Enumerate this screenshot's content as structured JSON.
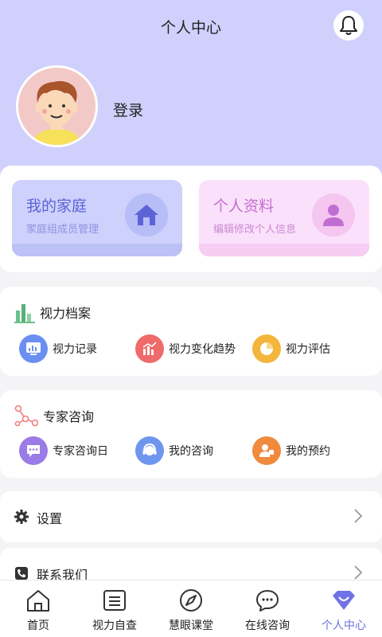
{
  "header": {
    "title": "个人中心",
    "login_label": "登录"
  },
  "quick_cards": [
    {
      "title": "我的家庭",
      "subtitle": "家庭组成员管理",
      "icon": "home-icon"
    },
    {
      "title": "个人资料",
      "subtitle": "编辑修改个人信息",
      "icon": "person-icon"
    }
  ],
  "vision_section": {
    "title": "视力档案",
    "items": [
      {
        "label": "视力记录",
        "icon": "vision-record-icon",
        "color": "#6b8ff0"
      },
      {
        "label": "视力变化趋势",
        "icon": "trend-chart-icon",
        "color": "#ef6a6a"
      },
      {
        "label": "视力评估",
        "icon": "pie-assessment-icon",
        "color": "#f3b53b"
      }
    ]
  },
  "expert_section": {
    "title": "专家咨询",
    "items": [
      {
        "label": "专家咨询日",
        "icon": "chat-bubble-icon",
        "color": "#9b7be6"
      },
      {
        "label": "我的咨询",
        "icon": "headset-icon",
        "color": "#6f96ef"
      },
      {
        "label": "我的预约",
        "icon": "appointment-icon",
        "color": "#f08a3d"
      }
    ]
  },
  "settings": {
    "label": "设置"
  },
  "contact": {
    "label": "联系我们"
  },
  "tabs": [
    {
      "label": "首页",
      "icon": "home-tab-icon"
    },
    {
      "label": "视力自查",
      "icon": "eye-chart-icon"
    },
    {
      "label": "慧眼课堂",
      "icon": "compass-icon"
    },
    {
      "label": "在线咨询",
      "icon": "chat-icon"
    },
    {
      "label": "个人中心",
      "icon": "diamond-heart-icon",
      "active": true
    }
  ],
  "colors": {
    "hero_bg": "#cfd0fb",
    "accent": "#6c6fe0"
  }
}
